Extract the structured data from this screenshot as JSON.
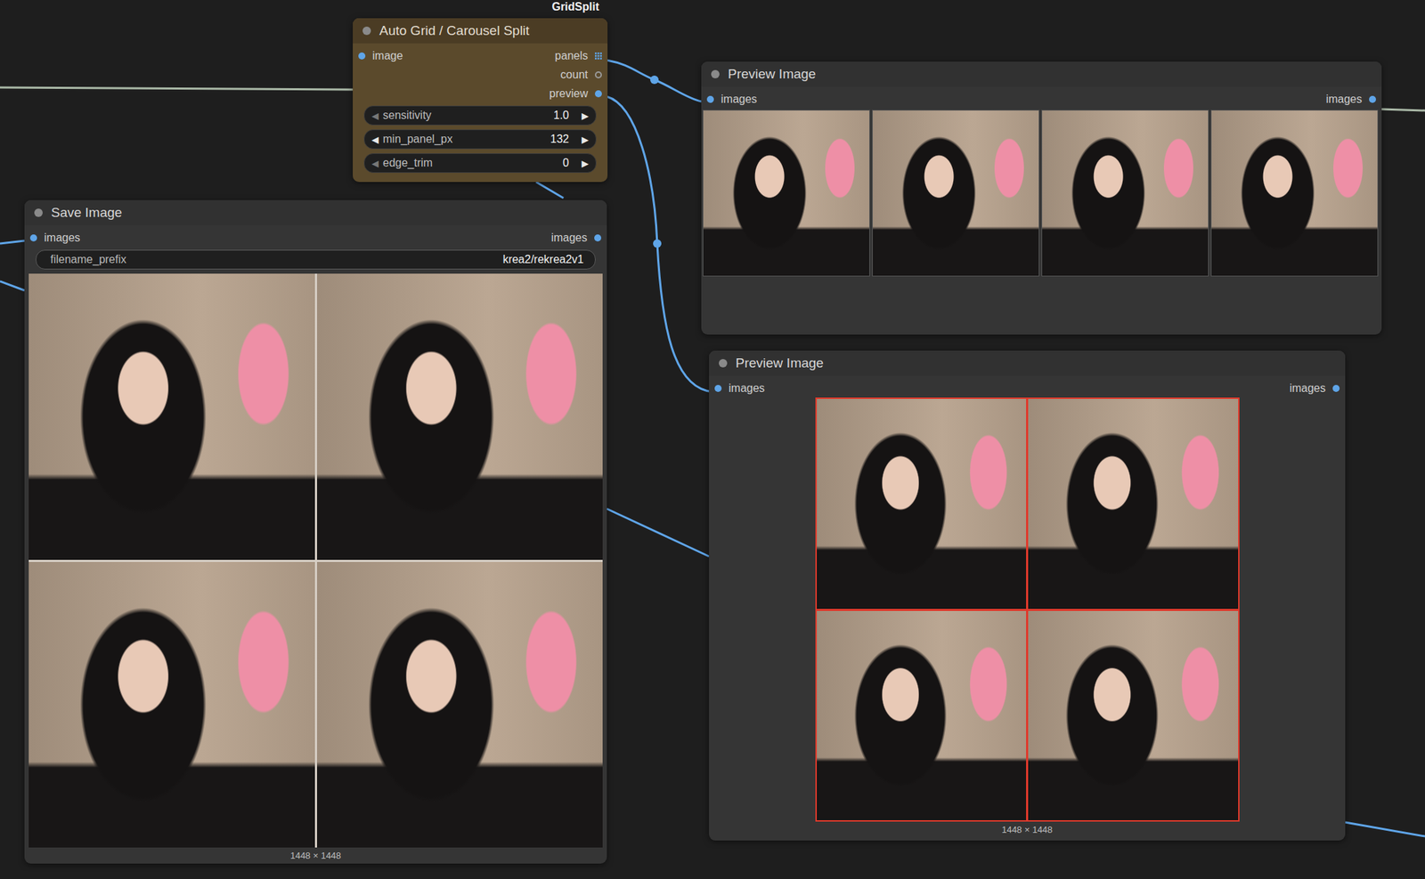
{
  "badge": "GridSplit",
  "arrows": {
    "left": "◀",
    "right": "▶"
  },
  "grid_split": {
    "title": "Auto Grid / Carousel Split",
    "inputs": [
      {
        "label": "image",
        "connected": true
      }
    ],
    "outputs": [
      {
        "label": "panels",
        "kind": "list",
        "connected": true
      },
      {
        "label": "count",
        "kind": "dot",
        "connected": false
      },
      {
        "label": "preview",
        "kind": "dot",
        "connected": true
      }
    ],
    "widgets": [
      {
        "label": "sensitivity",
        "value": "1.0",
        "min_reached": true
      },
      {
        "label": "min_panel_px",
        "value": "132",
        "min_reached": false
      },
      {
        "label": "edge_trim",
        "value": "0",
        "min_reached": true
      }
    ]
  },
  "save_image": {
    "title": "Save Image",
    "input": "images",
    "output": "images",
    "field": {
      "label": "filename_prefix",
      "value": "krea2/rekrea2v1"
    },
    "panels": [
      {
        "kind": "photo"
      },
      {
        "kind": "photo"
      },
      {
        "kind": "photo"
      },
      {
        "kind": "photo"
      }
    ],
    "size": "1448 × 1448"
  },
  "preview_strip": {
    "title": "Preview Image",
    "input": "images",
    "output": "images",
    "panels": [
      {
        "kind": "photo"
      },
      {
        "kind": "photo"
      },
      {
        "kind": "photo"
      },
      {
        "kind": "photo"
      }
    ]
  },
  "preview_grid": {
    "title": "Preview Image",
    "input": "images",
    "output": "images",
    "panels": [
      {
        "kind": "photo"
      },
      {
        "kind": "photo"
      },
      {
        "kind": "photo"
      },
      {
        "kind": "photo"
      }
    ],
    "size": "1448 × 1448"
  }
}
